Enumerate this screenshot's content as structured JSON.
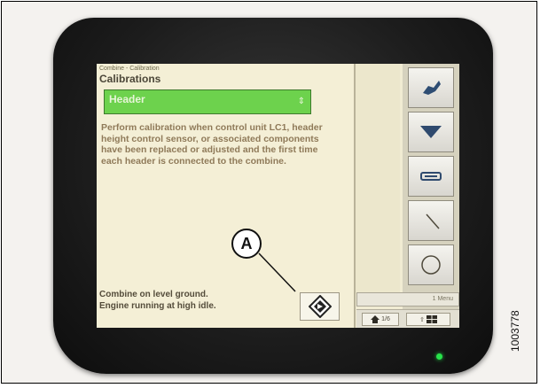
{
  "screen": {
    "breadcrumb": "Combine - Calibration",
    "title": "Calibrations",
    "dropdown": {
      "value": "Header",
      "arrow": "⇕"
    },
    "description": "Perform calibration when control unit LC1, header height control sensor, or associated components have been replaced or adjusted and the first time each header is connected to the combine.",
    "status_line_1": "Combine on level ground.",
    "status_line_2": "Engine running at high idle.",
    "go_button_icon": "diamond-go-icon",
    "lower_field": "1 Menu",
    "bottom_bar": {
      "home_label": "1/6",
      "arrow_label": "⇧"
    }
  },
  "annotation": {
    "callout_label": "A"
  },
  "figure_id": "1003778",
  "colors": {
    "dropdown_green": "#6dd24d",
    "screen_bg": "#f4efd6",
    "led_green": "#27e34a"
  }
}
